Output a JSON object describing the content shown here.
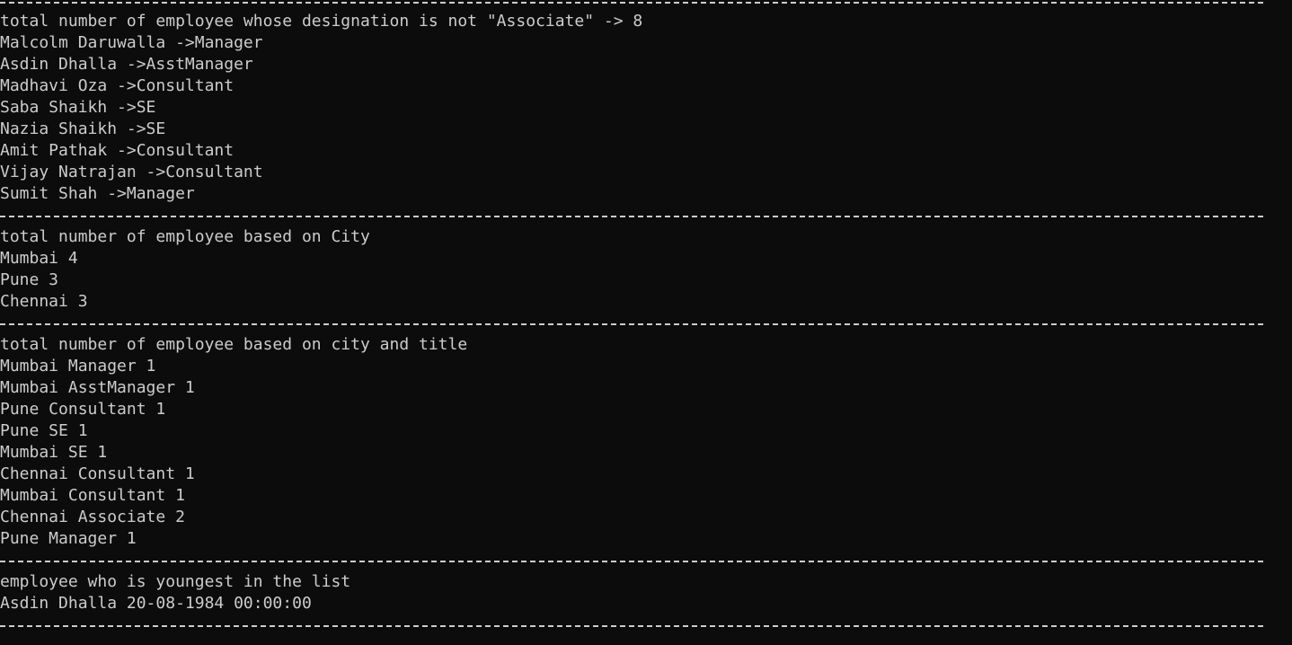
{
  "console": {
    "separator": "----------------------------------------------------------------------------------------------------------------------------",
    "sections": [
      {
        "heading": "total number of employee whose designation is not \"Associate\" -> 8",
        "lines": [
          "Malcolm Daruwalla ->Manager",
          "Asdin Dhalla ->AsstManager",
          "Madhavi Oza ->Consultant",
          "Saba Shaikh ->SE",
          "Nazia Shaikh ->SE",
          "Amit Pathak ->Consultant",
          "Vijay Natrajan ->Consultant",
          "Sumit Shah ->Manager"
        ]
      },
      {
        "heading": "total number of employee based on City",
        "lines": [
          "Mumbai 4",
          "Pune 3",
          "Chennai 3"
        ]
      },
      {
        "heading": "total number of employee based on city and title",
        "lines": [
          "Mumbai Manager 1",
          "Mumbai AsstManager 1",
          "Pune Consultant 1",
          "Pune SE 1",
          "Mumbai SE 1",
          "Chennai Consultant 1",
          "Mumbai Consultant 1",
          "Chennai Associate 2",
          "Pune Manager 1"
        ]
      },
      {
        "heading": "employee who is youngest in the list",
        "lines": [
          "Asdin Dhalla 20-08-1984 00:00:00"
        ]
      }
    ]
  },
  "colors": {
    "background": "#0c0c0c",
    "text": "#cccccc"
  }
}
